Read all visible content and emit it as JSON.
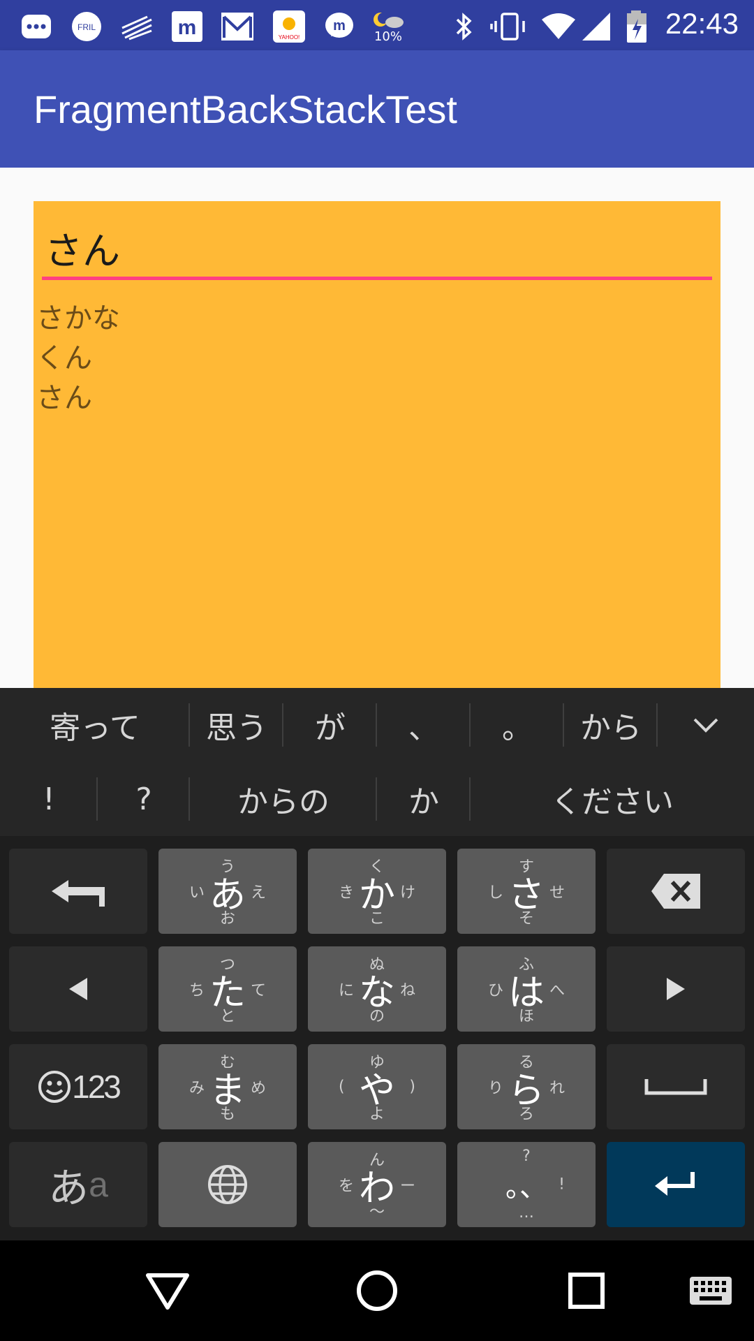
{
  "status_bar": {
    "time": "22:43",
    "weather_percent": "10%",
    "colors": {
      "bg": "#303f9f"
    }
  },
  "app_bar": {
    "title": "FragmentBackStackTest",
    "colors": {
      "bg": "#3f51b5"
    }
  },
  "editor": {
    "input_value": "さん",
    "items": [
      "さかな",
      "くん",
      "さん"
    ],
    "colors": {
      "card": "#ffb936",
      "underline": "#ff4081"
    }
  },
  "keyboard": {
    "candidates_row1": [
      "寄って",
      "思う",
      "が",
      "、",
      "。",
      "から"
    ],
    "candidates_row2": [
      "!",
      "?",
      "からの",
      "か",
      "ください"
    ],
    "keys": {
      "a": {
        "main": "あ",
        "top": "う",
        "left": "い",
        "right": "え",
        "bottom": "お"
      },
      "ka": {
        "main": "か",
        "top": "く",
        "left": "き",
        "right": "け",
        "bottom": "こ"
      },
      "sa": {
        "main": "さ",
        "top": "す",
        "left": "し",
        "right": "せ",
        "bottom": "そ"
      },
      "ta": {
        "main": "た",
        "top": "つ",
        "left": "ち",
        "right": "て",
        "bottom": "と"
      },
      "na": {
        "main": "な",
        "top": "ぬ",
        "left": "に",
        "right": "ね",
        "bottom": "の"
      },
      "ha": {
        "main": "は",
        "top": "ふ",
        "left": "ひ",
        "right": "へ",
        "bottom": "ほ"
      },
      "ma": {
        "main": "ま",
        "top": "む",
        "left": "み",
        "right": "め",
        "bottom": "も"
      },
      "ya": {
        "main": "や",
        "top": "ゆ",
        "left": "(",
        "right": ")",
        "bottom": "よ"
      },
      "ra": {
        "main": "ら",
        "top": "る",
        "left": "り",
        "right": "れ",
        "bottom": "ろ"
      },
      "wa": {
        "main": "わ",
        "top": "ん",
        "left": "を",
        "right": "ー",
        "bottom": "〜"
      },
      "punct": {
        "main": "。、",
        "top": "?",
        "left": "",
        "right": "!",
        "bottom": "…"
      }
    },
    "mode_label": "123",
    "kana_label": "あ",
    "kana_label_sub": "a",
    "colors": {
      "bg": "#212121",
      "key": "#5a5a5a",
      "key_dark": "#2b2b2b",
      "enter": "#01395a"
    }
  },
  "icons": [
    "more-icon",
    "fril-icon",
    "zebra-icon",
    "mercari-icon",
    "mail-icon",
    "yahoo-weather-icon",
    "messenger-icon",
    "weather-icon",
    "bluetooth-icon",
    "vibrate-icon",
    "wifi-icon",
    "signal-icon",
    "battery-icon"
  ]
}
